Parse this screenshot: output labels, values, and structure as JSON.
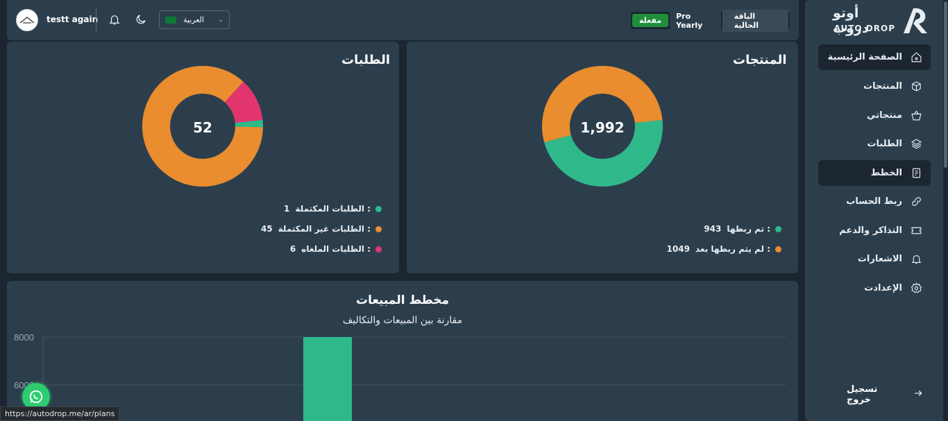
{
  "brand": {
    "arabic": "أوتو دروب",
    "english": "AUTO DROP"
  },
  "header": {
    "username": "testt again",
    "language": "العربية",
    "plan": {
      "status": "مفعلة",
      "name": "Pro Yearly",
      "label": "الباقة الحالية"
    }
  },
  "sidebar": {
    "items": [
      {
        "label": "الصفحة الرئيسية",
        "icon": "home-icon",
        "active": true
      },
      {
        "label": "المنتجات",
        "icon": "box-icon",
        "active": false
      },
      {
        "label": "منتجاتي",
        "icon": "basket-icon",
        "active": false
      },
      {
        "label": "الطلبات",
        "icon": "layers-icon",
        "active": false
      },
      {
        "label": "الخطط",
        "icon": "receipt-icon",
        "active": true
      },
      {
        "label": "ربط الحساب",
        "icon": "link-icon",
        "active": false
      },
      {
        "label": "التذاكر والدعم",
        "icon": "ticket-icon",
        "active": false
      },
      {
        "label": "الاشعارات",
        "icon": "bell-icon",
        "active": false
      },
      {
        "label": "الإعدادت",
        "icon": "gear-icon",
        "active": false
      }
    ],
    "logout": "تسجيل خروج"
  },
  "orders_card": {
    "title": "الطلبات",
    "total": "52",
    "legend": [
      {
        "label": "الطلبات المكتملة :",
        "value": "1",
        "color": "#2fb98b"
      },
      {
        "label": "الطلبات غير المكتملة :",
        "value": "45",
        "color": "#e98d2e"
      },
      {
        "label": "الطلبات الملغاه :",
        "value": "6",
        "color": "#e2356e"
      }
    ]
  },
  "products_card": {
    "title": "المنتجات",
    "total": "1,992",
    "legend": [
      {
        "label": "تم ربطها :",
        "value": "943",
        "color": "#2fb98b"
      },
      {
        "label": "لم يتم ربطها بعد :",
        "value": "1049",
        "color": "#e98d2e"
      }
    ]
  },
  "sales_card": {
    "title": "مخطط المبيعات",
    "subtitle": "مقارنة بين المبيعات والتكاليف"
  },
  "chart_data": [
    {
      "type": "pie",
      "labels": [
        "الطلبات المكتملة",
        "الطلبات غير المكتملة",
        "الطلبات الملغاه"
      ],
      "values": [
        1,
        45,
        6
      ],
      "colors": [
        "#2fb98b",
        "#e98d2e",
        "#e2356e"
      ]
    },
    {
      "type": "pie",
      "labels": [
        "تم ربطها",
        "لم يتم ربطها بعد"
      ],
      "values": [
        943,
        1049
      ],
      "colors": [
        "#2fb98b",
        "#e98d2e"
      ]
    },
    {
      "type": "bar",
      "title": "مخطط المبيعات",
      "subtitle": "مقارنة بين المبيعات والتكاليف",
      "yticks": [
        "8000",
        "6000"
      ],
      "ylim": [
        0,
        8000
      ],
      "values": [
        8000
      ],
      "colors": [
        "#2fb98b"
      ],
      "grid": true
    }
  ],
  "status_url": "https://autodrop.me/ar/plans"
}
